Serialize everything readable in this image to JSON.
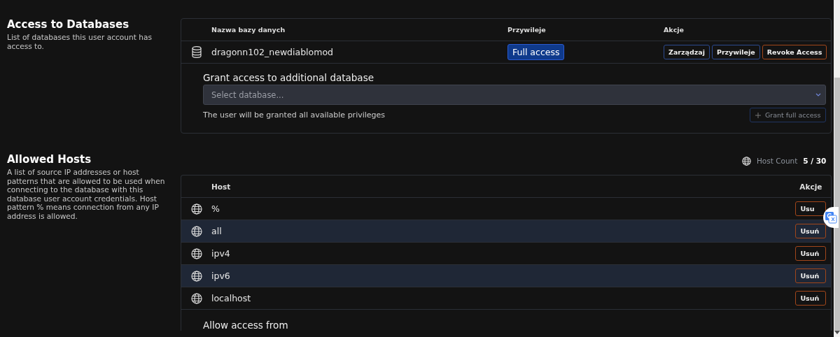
{
  "databases": {
    "title": "Access to Databases",
    "description": "List of databases this user account has access to.",
    "columns": [
      "Nazwa bazy danych",
      "Przywileje",
      "Akcje"
    ],
    "rows": [
      {
        "name": "dragonn102_newdiablomod",
        "privilege": "Full access",
        "actions": [
          {
            "label": "Zarządzaj",
            "kind": "primary"
          },
          {
            "label": "Przywileje",
            "kind": "primary"
          },
          {
            "label": "Revoke Access",
            "kind": "danger"
          }
        ]
      }
    ],
    "grant": {
      "title": "Grant access to additional database",
      "placeholder": "Select database...",
      "note": "The user will be granted all available privileges",
      "button": "Grant full access",
      "disabled": true
    }
  },
  "hosts": {
    "title": "Allowed Hosts",
    "description": "A list of source IP addresses or host patterns that are allowed to be used when connecting to the database with this database user account credentials. Host pattern % means connection from any IP address is allowed.",
    "count_label": "Host Count",
    "count": "5 / 30",
    "columns": [
      "Host",
      "Akcje"
    ],
    "rows": [
      {
        "host": "%",
        "action": "Usu"
      },
      {
        "host": "all",
        "action": "Usuń"
      },
      {
        "host": "ipv4",
        "action": "Usuń"
      },
      {
        "host": "ipv6",
        "action": "Usuń"
      },
      {
        "host": "localhost",
        "action": "Usuń"
      }
    ],
    "allow_title": "Allow access from"
  }
}
